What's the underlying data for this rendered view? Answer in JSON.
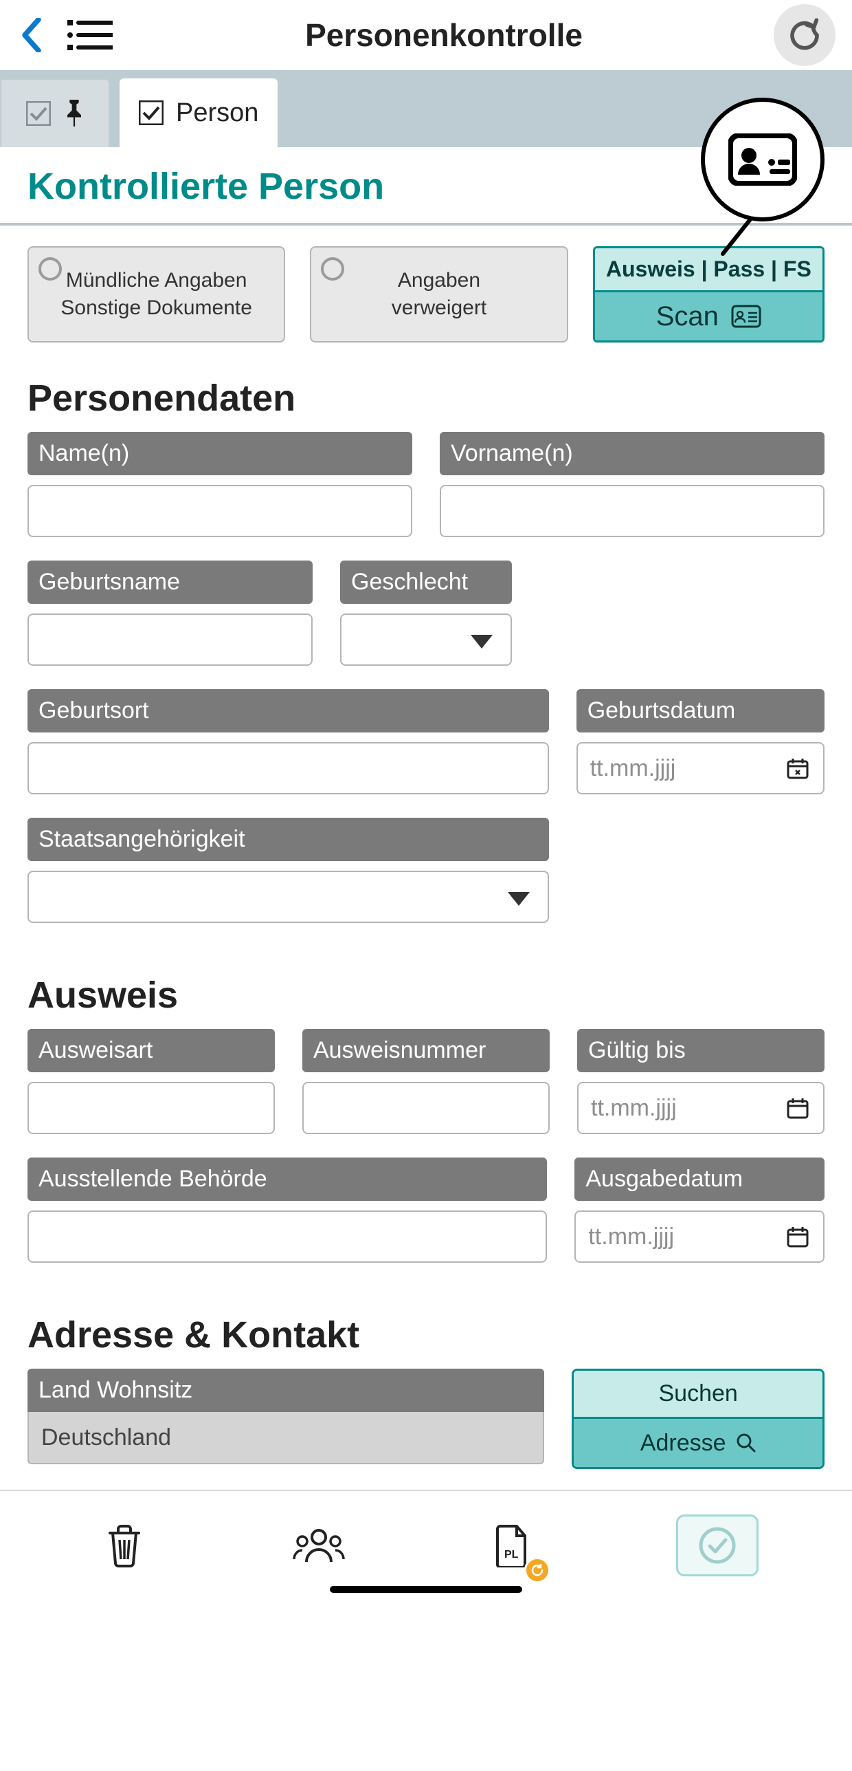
{
  "header": {
    "title": "Personenkontrolle"
  },
  "tabs": {
    "active_label": "Person"
  },
  "section_title": "Kontrollierte Person",
  "options": {
    "verbal": {
      "line1": "Mündliche Angaben",
      "line2": "Sonstige Dokumente"
    },
    "refused": {
      "line1": "Angaben",
      "line2": "verweigert"
    },
    "scan_top": "Ausweis  |  Pass  |  FS",
    "scan_bottom": "Scan"
  },
  "personendaten": {
    "heading": "Personendaten",
    "name_label": "Name(n)",
    "vorname_label": "Vorname(n)",
    "geburtsname_label": "Geburtsname",
    "geschlecht_label": "Geschlecht",
    "geburtsort_label": "Geburtsort",
    "geburtsdatum_label": "Geburtsdatum",
    "date_placeholder": "tt.mm.jjjj",
    "staatsang_label": "Staatsangehörigkeit"
  },
  "ausweis": {
    "heading": "Ausweis",
    "art_label": "Ausweisart",
    "nummer_label": "Ausweisnummer",
    "gueltig_label": "Gültig bis",
    "behoerde_label": "Ausstellende Behörde",
    "ausgabe_label": "Ausgabedatum"
  },
  "adresse": {
    "heading": "Adresse & Kontakt",
    "land_label": "Land Wohnsitz",
    "land_value": "Deutschland",
    "suchen": "Suchen",
    "adresse_btn": "Adresse"
  }
}
